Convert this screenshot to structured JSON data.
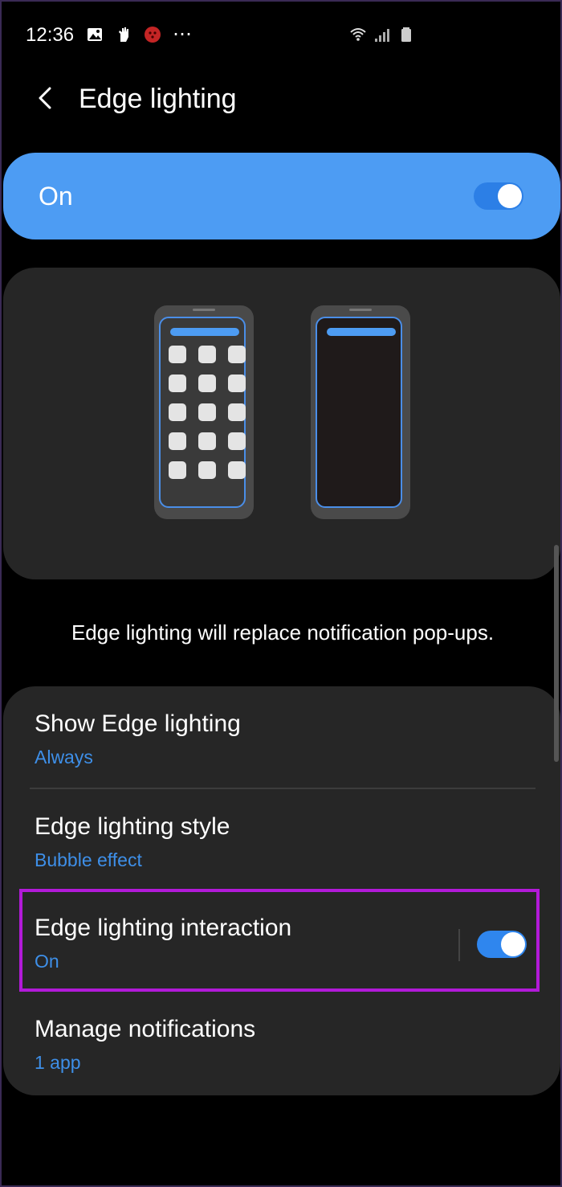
{
  "status_bar": {
    "time": "12:36",
    "left_icons": [
      "gallery-icon",
      "hand-icon",
      "ladybug-app-icon",
      "more-dots-icon"
    ],
    "right_icons": [
      "wifi-icon",
      "signal-icon",
      "battery-icon"
    ],
    "more_glyph": "⋯"
  },
  "app_bar": {
    "back_glyph": "<",
    "title": "Edge lighting"
  },
  "master": {
    "label": "On",
    "toggle_on": true,
    "color": "#4d9cf3"
  },
  "preview": {
    "phones": [
      "phone-with-apps",
      "phone-blank"
    ]
  },
  "description": "Edge lighting will replace notification pop-ups.",
  "settings": [
    {
      "title": "Show Edge lighting",
      "subtitle": "Always"
    },
    {
      "title": "Edge lighting style",
      "subtitle": "Bubble effect"
    },
    {
      "title": "Edge lighting interaction",
      "subtitle": "On",
      "toggle_on": true
    },
    {
      "title": "Manage notifications",
      "subtitle": "1 app"
    }
  ],
  "colors": {
    "accent": "#4d9cf3",
    "subtitle": "#3e8fe8",
    "highlight": "#b21ad8",
    "card": "#262626"
  }
}
